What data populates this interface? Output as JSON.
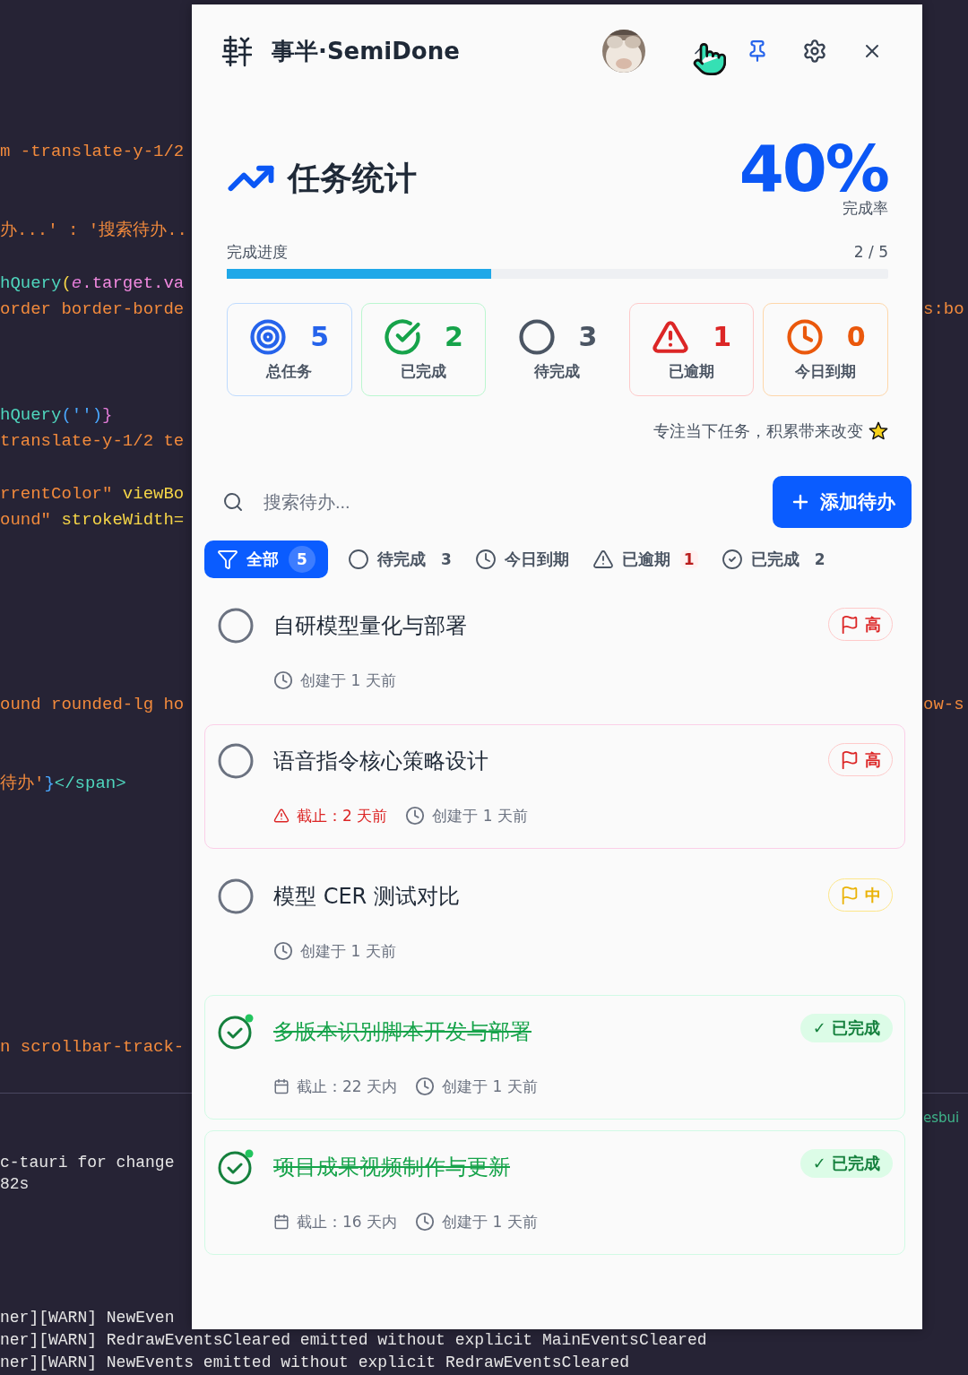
{
  "editor": {
    "lines": [
      {
        "parts": [
          {
            "text": "m -translate-y-1/2",
            "kind": "string"
          }
        ]
      },
      {
        "parts": [
          {
            "text": "办...' : '搜索待办..",
            "kind": "string"
          }
        ]
      },
      {
        "parts": [
          {
            "text": "hQuery",
            "kind": "func"
          },
          {
            "text": "(",
            "kind": "paren"
          },
          {
            "text": "e",
            "kind": "var"
          },
          {
            "text": ".target.va",
            "kind": "prop"
          }
        ]
      },
      {
        "parts": [
          {
            "text": "order border-borde",
            "kind": "string"
          }
        ],
        "right": "s:bo"
      },
      {
        "parts": [
          {
            "text": "hQuery",
            "kind": "func"
          },
          {
            "text": "('')",
            "kind": "punct"
          },
          {
            "text": "}",
            "kind": "brace"
          }
        ]
      },
      {
        "parts": [
          {
            "text": "translate-y-1/2 te",
            "kind": "string"
          }
        ]
      },
      {
        "parts": [
          {
            "text": "rrentColor\" ",
            "kind": "string"
          },
          {
            "text": "viewBo",
            "kind": "attr"
          }
        ]
      },
      {
        "parts": [
          {
            "text": "ound\" ",
            "kind": "string"
          },
          {
            "text": "strokeWidth=",
            "kind": "attr"
          }
        ]
      },
      {
        "parts": [
          {
            "text": "ound rounded-lg ho",
            "kind": "string"
          }
        ],
        "right": "ow-s"
      },
      {
        "parts": [
          {
            "text": "待办'",
            "kind": "string"
          },
          {
            "text": "}",
            "kind": "punct"
          },
          {
            "text": "</span>",
            "kind": "tag"
          }
        ]
      },
      {
        "parts": [
          {
            "text": "n scrollbar-track-",
            "kind": "string"
          }
        ]
      }
    ]
  },
  "terminal": {
    "lines": [
      {
        "kind": "tool",
        "text": "esbui"
      },
      {
        "kind": "log",
        "text": "c-tauri for change"
      },
      {
        "kind": "log",
        "text": "82s"
      },
      {
        "kind": "log",
        "text": "ner][WARN] NewEven"
      },
      {
        "kind": "log",
        "text": "ner][WARN] RedrawEventsCleared emitted without explicit MainEventsCleared"
      },
      {
        "kind": "log",
        "text": "ner][WARN] NewEvents emitted without explicit RedrawEventsCleared"
      }
    ]
  },
  "app": {
    "title": "事半·SemiDone",
    "stats": {
      "title": "任务统计",
      "rate": "40%",
      "rate_label": "完成率",
      "progress_label": "完成进度",
      "progress_count": "2 / 5",
      "level": 0.4,
      "cards": [
        {
          "kind": "total",
          "value": "5",
          "label": "总任务"
        },
        {
          "kind": "done",
          "value": "2",
          "label": "已完成"
        },
        {
          "kind": "pending",
          "value": "3",
          "label": "待完成"
        },
        {
          "kind": "overdue",
          "value": "1",
          "label": "已逾期"
        },
        {
          "kind": "today",
          "value": "0",
          "label": "今日到期"
        }
      ]
    },
    "motto": "专注当下任务，积累带来改变",
    "search": {
      "placeholder": "搜索待办..."
    },
    "add_button": "添加待办",
    "filters": [
      {
        "kind": "all",
        "label": "全部",
        "count": "5",
        "selected": true
      },
      {
        "kind": "pending",
        "label": "待完成",
        "count": "3",
        "selected": false
      },
      {
        "kind": "today",
        "label": "今日到期",
        "selected": false
      },
      {
        "kind": "overdue",
        "label": "已逾期",
        "count": "1",
        "selected": false
      },
      {
        "kind": "done",
        "label": "已完成",
        "count": "2",
        "selected": false
      }
    ],
    "tasks": [
      {
        "title": "自研模型量化与部署",
        "done": false,
        "highlighted": false,
        "priority": {
          "kind": "high",
          "label": "高"
        },
        "created": "创建于 1 天前"
      },
      {
        "title": "语音指令核心策略设计",
        "done": false,
        "highlighted": true,
        "priority": {
          "kind": "high",
          "label": "高"
        },
        "deadline": {
          "kind": "overdue",
          "text": "截止：2 天前"
        },
        "created": "创建于 1 天前"
      },
      {
        "title": "模型 CER 测试对比",
        "done": false,
        "highlighted": false,
        "priority": {
          "kind": "medium",
          "label": "中"
        },
        "created": "创建于 1 天前"
      },
      {
        "title": "多版本识别脚本开发与部署",
        "done": true,
        "highlighted": false,
        "status": "✓ 已完成",
        "deadline": {
          "kind": "upcoming",
          "text": "截止：22 天内"
        },
        "created": "创建于 1 天前"
      },
      {
        "title": "项目成果视频制作与更新",
        "done": true,
        "highlighted": false,
        "status": "✓ 已完成",
        "deadline": {
          "kind": "upcoming",
          "text": "截止：16 天内"
        },
        "created": "创建于 1 天前"
      }
    ]
  }
}
